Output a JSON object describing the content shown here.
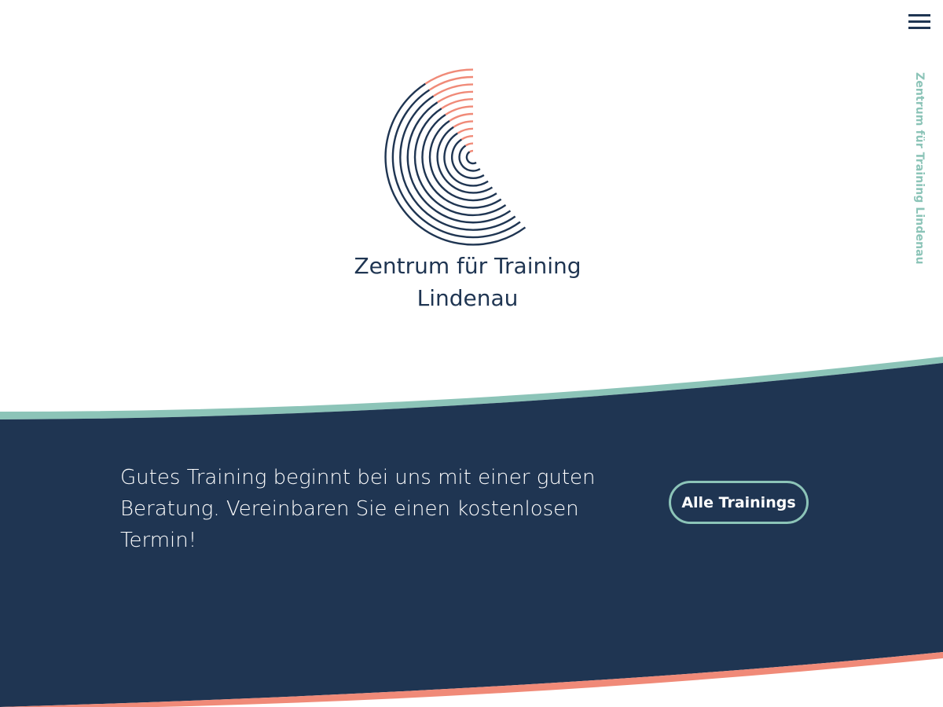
{
  "header": {
    "menu_icon": "hamburger-menu-icon",
    "side_title": "Zentrum für Training Lindenau"
  },
  "logo": {
    "icon": "concentric-arcs-logo",
    "title_line1": "Zentrum für Training",
    "title_line2": "Lindenau"
  },
  "cta": {
    "text": "Gutes Training beginnt bei uns mit einer guten Beratung. Vereinbaren Sie einen kostenlosen Termin!",
    "button_label": "Alle Trainings"
  },
  "colors": {
    "navy": "#1f3552",
    "teal": "#8cc4b8",
    "salmon": "#f08a78",
    "white": "#ffffff"
  }
}
